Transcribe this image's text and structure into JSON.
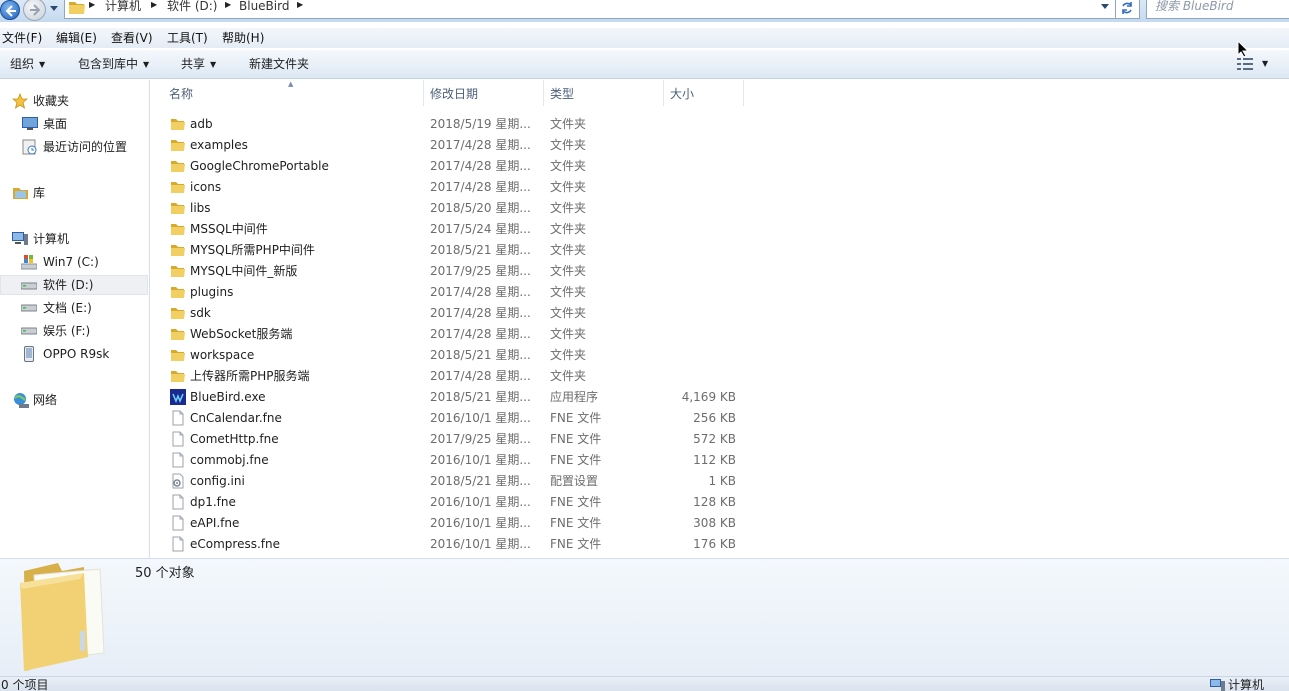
{
  "address": {
    "crumbs": [
      "计算机",
      "软件 (D:)",
      "BlueBird"
    ],
    "search_placeholder": "搜索 BlueBird"
  },
  "menu": [
    "文件(F)",
    "编辑(E)",
    "查看(V)",
    "工具(T)",
    "帮助(H)"
  ],
  "toolbar": {
    "organize": "组织",
    "include_in_library": "包含到库中",
    "share": "共享",
    "new_folder": "新建文件夹"
  },
  "nav": {
    "favorites": "收藏夹",
    "desktop": "桌面",
    "recent": "最近访问的位置",
    "libraries": "库",
    "computer": "计算机",
    "drives": [
      "Win7 (C:)",
      "软件 (D:)",
      "文档 (E:)",
      "娱乐 (F:)",
      "OPPO R9sk"
    ],
    "network": "网络"
  },
  "columns": {
    "name": "名称",
    "date": "修改日期",
    "type": "类型",
    "size": "大小"
  },
  "files": [
    {
      "name": "adb",
      "date": "2018/5/19 星期...",
      "type": "文件夹",
      "size": "",
      "icon": "folder-icon"
    },
    {
      "name": "examples",
      "date": "2017/4/28 星期...",
      "type": "文件夹",
      "size": "",
      "icon": "folder-icon"
    },
    {
      "name": "GoogleChromePortable",
      "date": "2017/4/28 星期...",
      "type": "文件夹",
      "size": "",
      "icon": "folder-icon"
    },
    {
      "name": "icons",
      "date": "2017/4/28 星期...",
      "type": "文件夹",
      "size": "",
      "icon": "folder-icon"
    },
    {
      "name": "libs",
      "date": "2018/5/20 星期...",
      "type": "文件夹",
      "size": "",
      "icon": "folder-icon"
    },
    {
      "name": "MSSQL中间件",
      "date": "2017/5/24 星期...",
      "type": "文件夹",
      "size": "",
      "icon": "folder-icon"
    },
    {
      "name": "MYSQL所需PHP中间件",
      "date": "2018/5/21 星期...",
      "type": "文件夹",
      "size": "",
      "icon": "folder-icon"
    },
    {
      "name": "MYSQL中间件_新版",
      "date": "2017/9/25 星期...",
      "type": "文件夹",
      "size": "",
      "icon": "folder-icon"
    },
    {
      "name": "plugins",
      "date": "2017/4/28 星期...",
      "type": "文件夹",
      "size": "",
      "icon": "folder-icon"
    },
    {
      "name": "sdk",
      "date": "2017/4/28 星期...",
      "type": "文件夹",
      "size": "",
      "icon": "folder-icon"
    },
    {
      "name": "WebSocket服务端",
      "date": "2017/4/28 星期...",
      "type": "文件夹",
      "size": "",
      "icon": "folder-icon"
    },
    {
      "name": "workspace",
      "date": "2018/5/21 星期...",
      "type": "文件夹",
      "size": "",
      "icon": "folder-icon"
    },
    {
      "name": "上传器所需PHP服务端",
      "date": "2017/4/28 星期...",
      "type": "文件夹",
      "size": "",
      "icon": "folder-icon"
    },
    {
      "name": "BlueBird.exe",
      "date": "2018/5/21 星期...",
      "type": "应用程序",
      "size": "4,169 KB",
      "icon": "exe-icon"
    },
    {
      "name": "CnCalendar.fne",
      "date": "2016/10/1 星期...",
      "type": "FNE 文件",
      "size": "256 KB",
      "icon": "file-icon"
    },
    {
      "name": "CometHttp.fne",
      "date": "2017/9/25 星期...",
      "type": "FNE 文件",
      "size": "572 KB",
      "icon": "file-icon"
    },
    {
      "name": "commobj.fne",
      "date": "2016/10/1 星期...",
      "type": "FNE 文件",
      "size": "112 KB",
      "icon": "file-icon"
    },
    {
      "name": "config.ini",
      "date": "2018/5/21 星期...",
      "type": "配置设置",
      "size": "1 KB",
      "icon": "ini-icon"
    },
    {
      "name": "dp1.fne",
      "date": "2016/10/1 星期...",
      "type": "FNE 文件",
      "size": "128 KB",
      "icon": "file-icon"
    },
    {
      "name": "eAPI.fne",
      "date": "2016/10/1 星期...",
      "type": "FNE 文件",
      "size": "308 KB",
      "icon": "file-icon"
    },
    {
      "name": "eCompress.fne",
      "date": "2016/10/1 星期...",
      "type": "FNE 文件",
      "size": "176 KB",
      "icon": "file-icon"
    }
  ],
  "details": {
    "count": "50 个对象"
  },
  "status": {
    "left": "0 个项目",
    "right": "计算机"
  },
  "colors": {
    "folder": "#e9c45a",
    "accent": "#1f5fb8",
    "muted": "#6d6d6d"
  }
}
